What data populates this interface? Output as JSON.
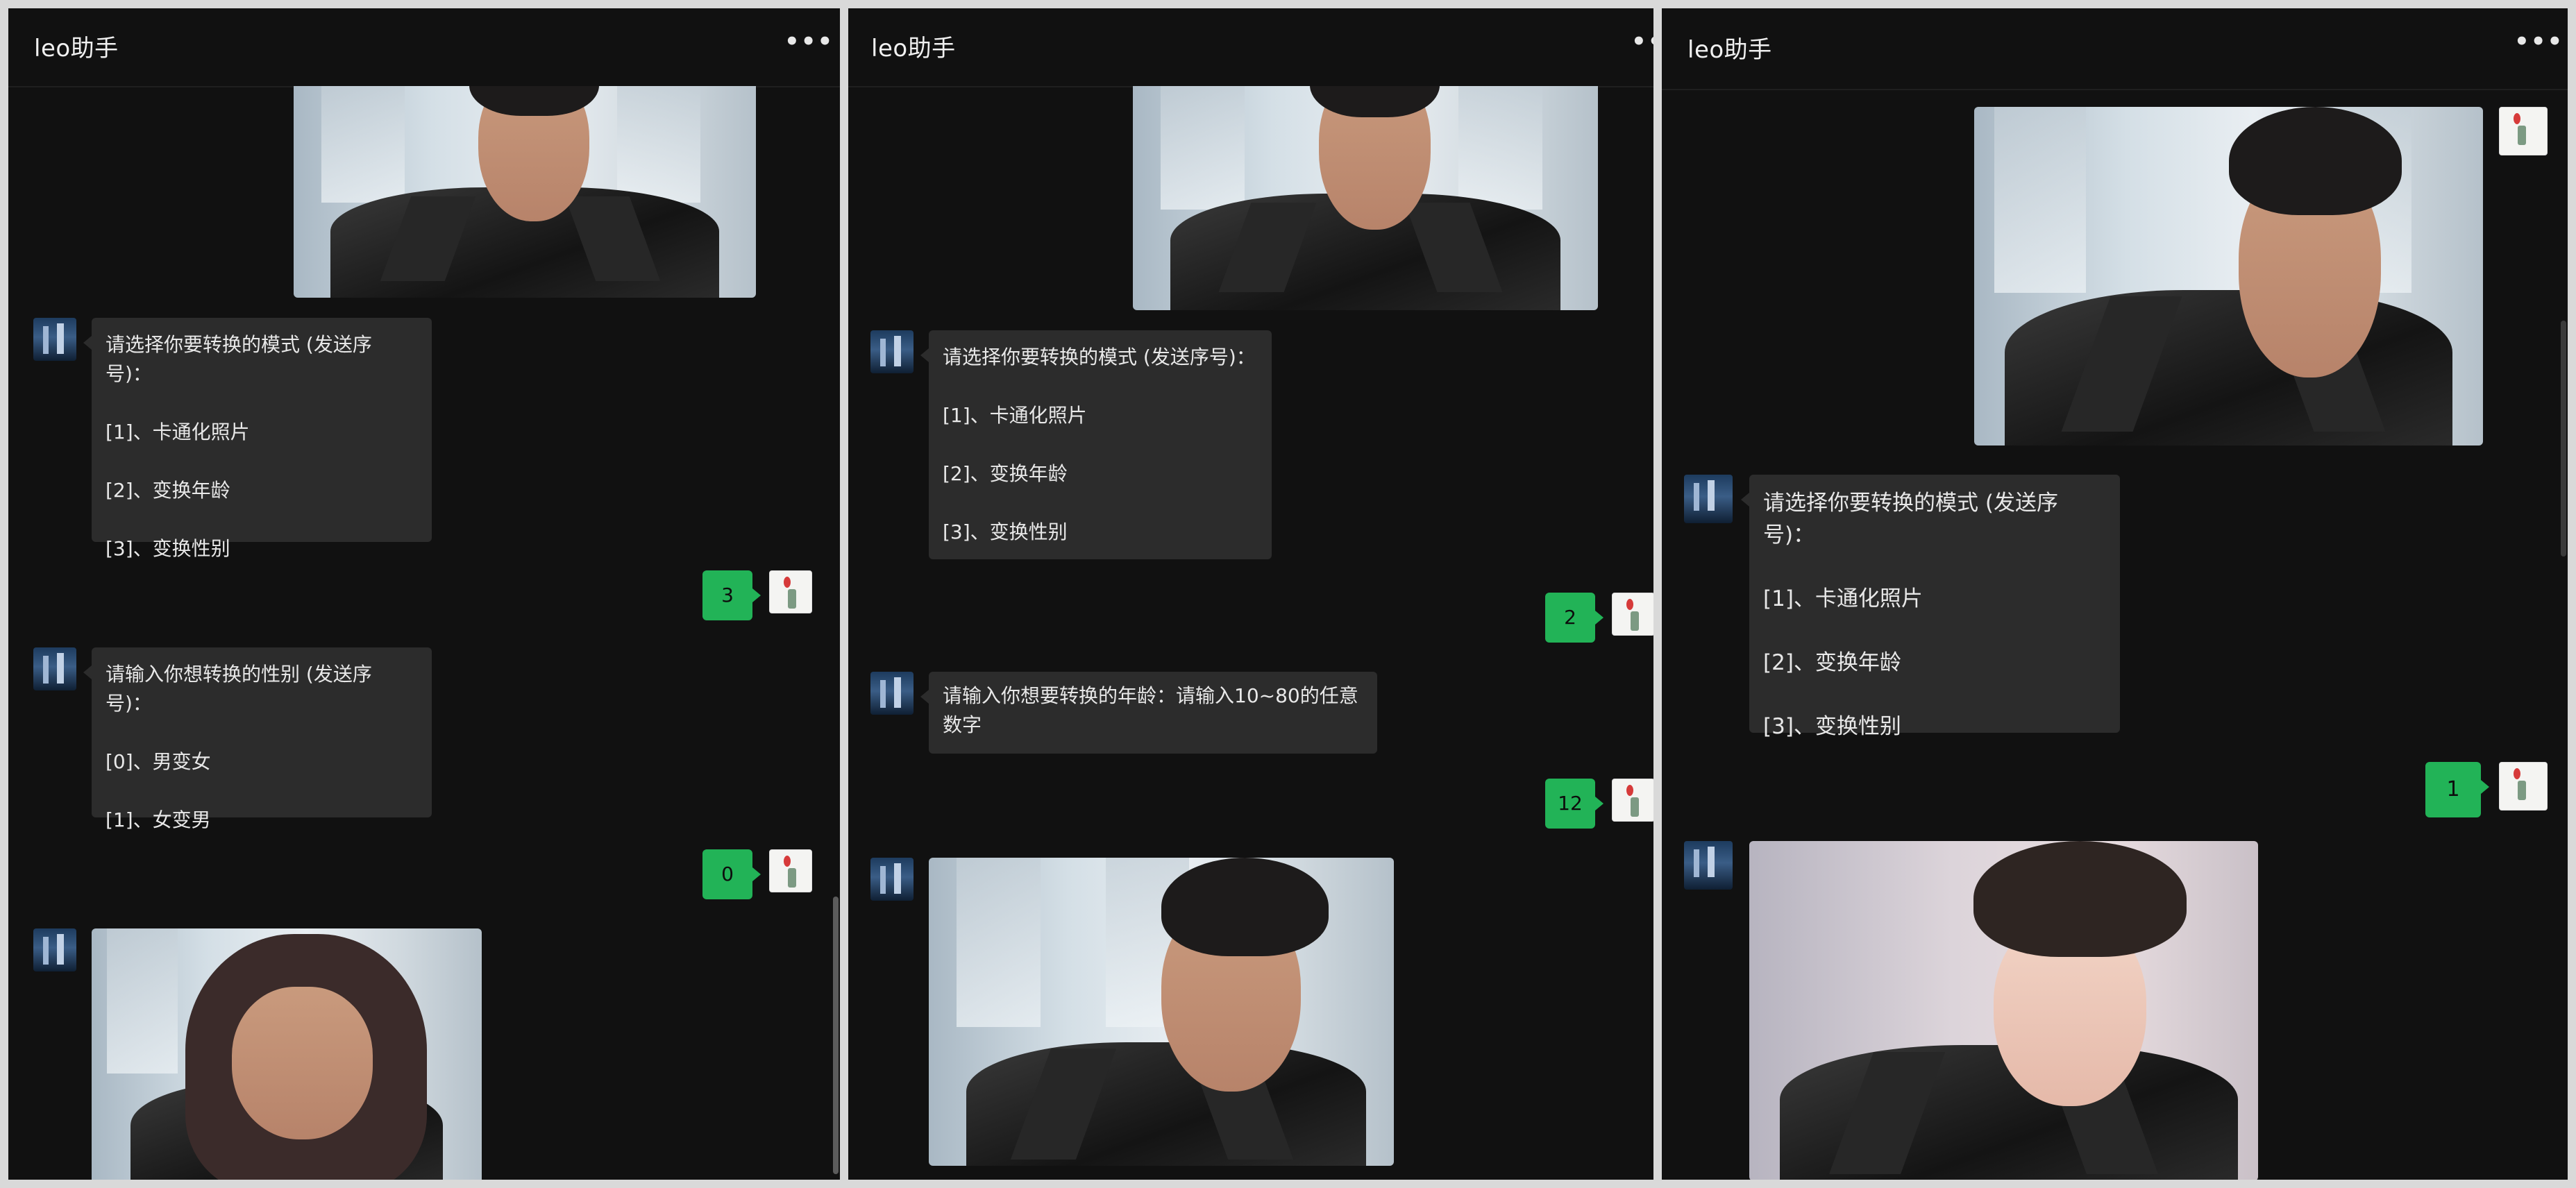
{
  "panels": [
    {
      "title": "leo助手",
      "messages": {
        "mode_prompt": {
          "header": "请选择你要转换的模式 (发送序号)：",
          "opt1": "[1]、卡通化照片",
          "opt2": "[2]、变换年龄",
          "opt3": "[3]、变换性别"
        },
        "reply1": "3",
        "gender_prompt": {
          "header": "请输入你想转换的性别 (发送序号)：",
          "opt0": "[0]、男变女",
          "opt1": "[1]、女变男"
        },
        "reply2": "0"
      }
    },
    {
      "title": "leo助手",
      "messages": {
        "mode_prompt": {
          "header": "请选择你要转换的模式 (发送序号)：",
          "opt1": "[1]、卡通化照片",
          "opt2": "[2]、变换年龄",
          "opt3": "[3]、变换性别"
        },
        "reply1": "2",
        "age_prompt": "请输入你想要转换的年龄：请输入10~80的任意数字",
        "reply2": "12"
      }
    },
    {
      "title": "leo助手",
      "messages": {
        "mode_prompt": {
          "header": "请选择你要转换的模式 (发送序号)：",
          "opt1": "[1]、卡通化照片",
          "opt2": "[2]、变换年龄",
          "opt3": "[3]、变换性别"
        },
        "reply1": "1"
      }
    }
  ],
  "icons": {
    "more": "more-horizontal-icon"
  },
  "colors": {
    "background": "#111111",
    "bubble_received": "#2c2c2c",
    "bubble_sent": "#22b357"
  }
}
